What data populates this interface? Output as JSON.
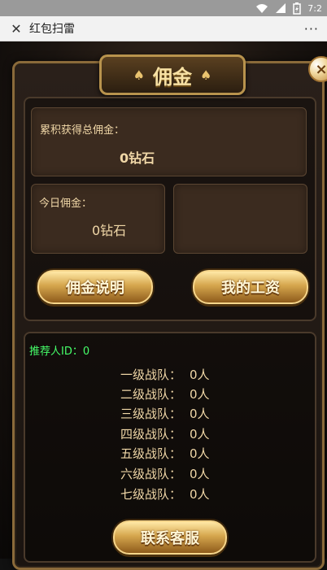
{
  "status_bar": {
    "time": "7:2",
    "icons": [
      "wifi-icon",
      "signal-icon",
      "battery-charging-icon"
    ]
  },
  "app_bar": {
    "title": "红包扫雷",
    "more_label": "···"
  },
  "panel": {
    "title": "佣金",
    "decor_left": "♠",
    "decor_right": "♠",
    "close_label": "×"
  },
  "cards": {
    "total": {
      "label": "累积获得总佣金：",
      "value": "0钻石"
    },
    "today": {
      "label": "今日佣金：",
      "value": "0钻石"
    }
  },
  "buttons": {
    "explain": "佣金说明",
    "salary": "我的工资",
    "contact": "联系客服"
  },
  "referrer": {
    "text": "推荐人ID：0"
  },
  "teams": [
    {
      "name": "一级战队：",
      "count": "0人"
    },
    {
      "name": "二级战队：",
      "count": "0人"
    },
    {
      "name": "三级战队：",
      "count": "0人"
    },
    {
      "name": "四级战队：",
      "count": "0人"
    },
    {
      "name": "五级战队：",
      "count": "0人"
    },
    {
      "name": "六级战队：",
      "count": "0人"
    },
    {
      "name": "七级战队：",
      "count": "0人"
    }
  ]
}
